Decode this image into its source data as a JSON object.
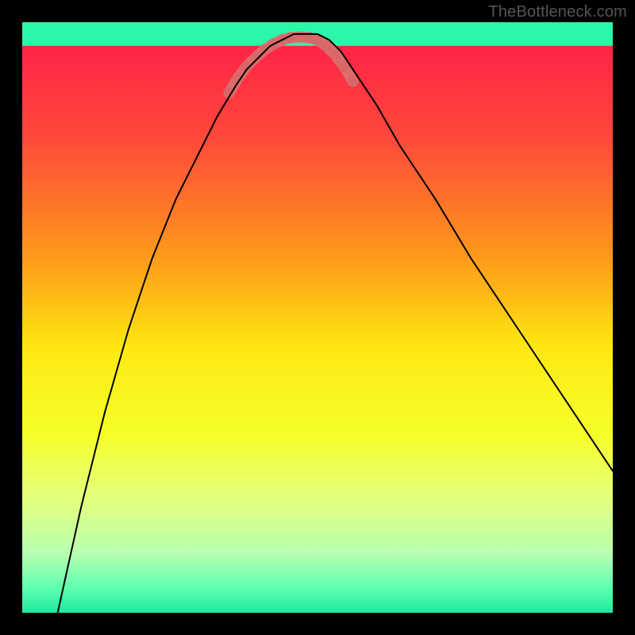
{
  "watermark": "TheBottleneck.com",
  "chart_data": {
    "type": "line",
    "title": "",
    "xlabel": "",
    "ylabel": "",
    "xlim": [
      0,
      100
    ],
    "ylim": [
      0,
      100
    ],
    "background_gradient_stops": [
      {
        "offset": 0.0,
        "color": "#ff1a4b"
      },
      {
        "offset": 0.2,
        "color": "#ff4a3a"
      },
      {
        "offset": 0.4,
        "color": "#ff9a1a"
      },
      {
        "offset": 0.55,
        "color": "#ffe812"
      },
      {
        "offset": 0.7,
        "color": "#f5ff2a"
      },
      {
        "offset": 0.8,
        "color": "#e6ff7a"
      },
      {
        "offset": 0.9,
        "color": "#b8ffb0"
      },
      {
        "offset": 0.96,
        "color": "#5bffb0"
      },
      {
        "offset": 1.0,
        "color": "#20e8a0"
      }
    ],
    "green_band": {
      "y_from": 96,
      "y_to": 100,
      "color": "#2cf7a8"
    },
    "series": [
      {
        "name": "bottleneck-curve",
        "color": "#000000",
        "stroke_width": 2,
        "x": [
          6,
          10,
          14,
          18,
          22,
          26,
          30,
          33,
          36,
          38,
          40,
          42,
          44,
          46,
          48,
          50,
          52,
          54,
          56,
          60,
          64,
          70,
          76,
          84,
          92,
          100
        ],
        "values": [
          0,
          18,
          34,
          48,
          60,
          70,
          78,
          84,
          89,
          92,
          94,
          96,
          97,
          98,
          98,
          98,
          97,
          95,
          92,
          86,
          79,
          70,
          60,
          48,
          36,
          24
        ]
      }
    ],
    "highlight": {
      "name": "optimal-range",
      "color": "#dd7070",
      "stroke_width": 14,
      "x": [
        35,
        36.5,
        38,
        39.5,
        41,
        42.5,
        44,
        45.5,
        47,
        48.5,
        50,
        51.5,
        53,
        54.5,
        56
      ],
      "values": [
        88,
        90.5,
        92.5,
        94,
        95.3,
        96.3,
        97,
        97.4,
        97.5,
        97.4,
        97,
        96,
        94.5,
        92.5,
        90
      ]
    },
    "highlight_dots": {
      "color": "#d86868",
      "radius": 7,
      "x": [
        35,
        36.5,
        38,
        39.5,
        41,
        42.5,
        44,
        45.5,
        47,
        48.5,
        50,
        51.5,
        53,
        54.5,
        56
      ],
      "values": [
        88,
        90.5,
        92.5,
        94,
        95.3,
        96.3,
        97,
        97.4,
        97.5,
        97.4,
        97,
        96,
        94.5,
        92.5,
        90
      ]
    }
  }
}
